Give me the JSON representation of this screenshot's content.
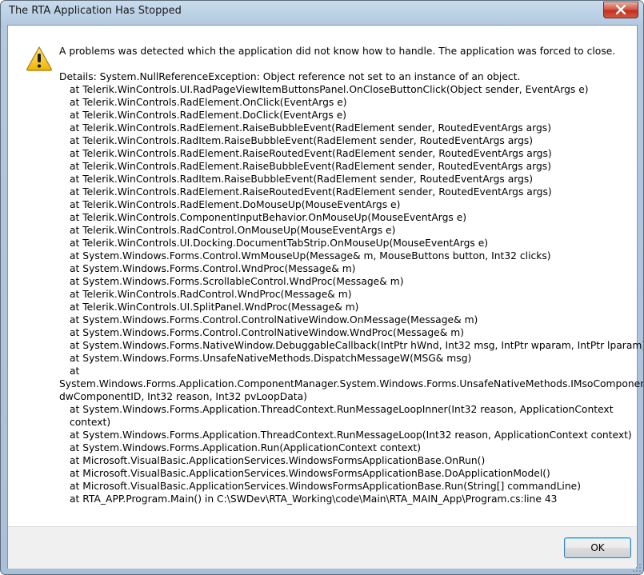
{
  "window": {
    "title": "The RTA Application Has Stopped"
  },
  "message": {
    "lead": "A problems was detected which the application did not know how to handle. The application was forced to close.",
    "details_header": "Details: System.NullReferenceException: Object reference not set to an instance of an object.",
    "stack": [
      "at Telerik.WinControls.UI.RadPageViewItemButtonsPanel.OnCloseButtonClick(Object sender, EventArgs e)",
      "at Telerik.WinControls.RadElement.OnClick(EventArgs e)",
      "at Telerik.WinControls.RadElement.DoClick(EventArgs e)",
      "at Telerik.WinControls.RadElement.RaiseBubbleEvent(RadElement sender, RoutedEventArgs args)",
      "at Telerik.WinControls.RadItem.RaiseBubbleEvent(RadElement sender, RoutedEventArgs args)",
      "at Telerik.WinControls.RadElement.RaiseRoutedEvent(RadElement sender, RoutedEventArgs args)",
      "at Telerik.WinControls.RadElement.RaiseBubbleEvent(RadElement sender, RoutedEventArgs args)",
      "at Telerik.WinControls.RadItem.RaiseBubbleEvent(RadElement sender, RoutedEventArgs args)",
      "at Telerik.WinControls.RadElement.RaiseRoutedEvent(RadElement sender, RoutedEventArgs args)",
      "at Telerik.WinControls.RadElement.DoMouseUp(MouseEventArgs e)",
      "at Telerik.WinControls.ComponentInputBehavior.OnMouseUp(MouseEventArgs e)",
      "at Telerik.WinControls.RadControl.OnMouseUp(MouseEventArgs e)",
      "at Telerik.WinControls.UI.Docking.DocumentTabStrip.OnMouseUp(MouseEventArgs e)",
      "at System.Windows.Forms.Control.WmMouseUp(Message& m, MouseButtons button, Int32 clicks)",
      "at System.Windows.Forms.Control.WndProc(Message& m)",
      "at System.Windows.Forms.ScrollableControl.WndProc(Message& m)",
      "at Telerik.WinControls.RadControl.WndProc(Message& m)",
      "at Telerik.WinControls.UI.SplitPanel.WndProc(Message& m)",
      "at System.Windows.Forms.Control.ControlNativeWindow.OnMessage(Message& m)",
      "at System.Windows.Forms.Control.ControlNativeWindow.WndProc(Message& m)",
      "at System.Windows.Forms.NativeWindow.DebuggableCallback(IntPtr hWnd, Int32 msg, IntPtr wparam, IntPtr lparam)",
      "at System.Windows.Forms.UnsafeNativeMethods.DispatchMessageW(MSG& msg)",
      "at"
    ],
    "wrapped_1": "System.Windows.Forms.Application.ComponentManager.System.Windows.Forms.UnsafeNativeMethods.IMsoComponentManager.FPushMessageLoop(IntPtr dwComponentID, Int32 reason, Int32 pvLoopData)",
    "wrapped_2": "at System.Windows.Forms.Application.ThreadContext.RunMessageLoopInner(Int32 reason, ApplicationContext context)",
    "stack_tail": [
      "at System.Windows.Forms.Application.ThreadContext.RunMessageLoop(Int32 reason, ApplicationContext context)",
      "at System.Windows.Forms.Application.Run(ApplicationContext context)",
      "at Microsoft.VisualBasic.ApplicationServices.WindowsFormsApplicationBase.OnRun()",
      "at Microsoft.VisualBasic.ApplicationServices.WindowsFormsApplicationBase.DoApplicationModel()",
      "at Microsoft.VisualBasic.ApplicationServices.WindowsFormsApplicationBase.Run(String[] commandLine)",
      "at RTA_APP.Program.Main() in C:\\SWDev\\RTA_Working\\code\\Main\\RTA_MAIN_App\\Program.cs:line 43"
    ]
  },
  "buttons": {
    "ok_label": "OK"
  },
  "icons": {
    "warning": "warning-icon",
    "close": "close-icon"
  },
  "colors": {
    "warning_fill": "#f5c518",
    "close_button": "#c2301f",
    "ok_border": "#3c7fb1"
  }
}
